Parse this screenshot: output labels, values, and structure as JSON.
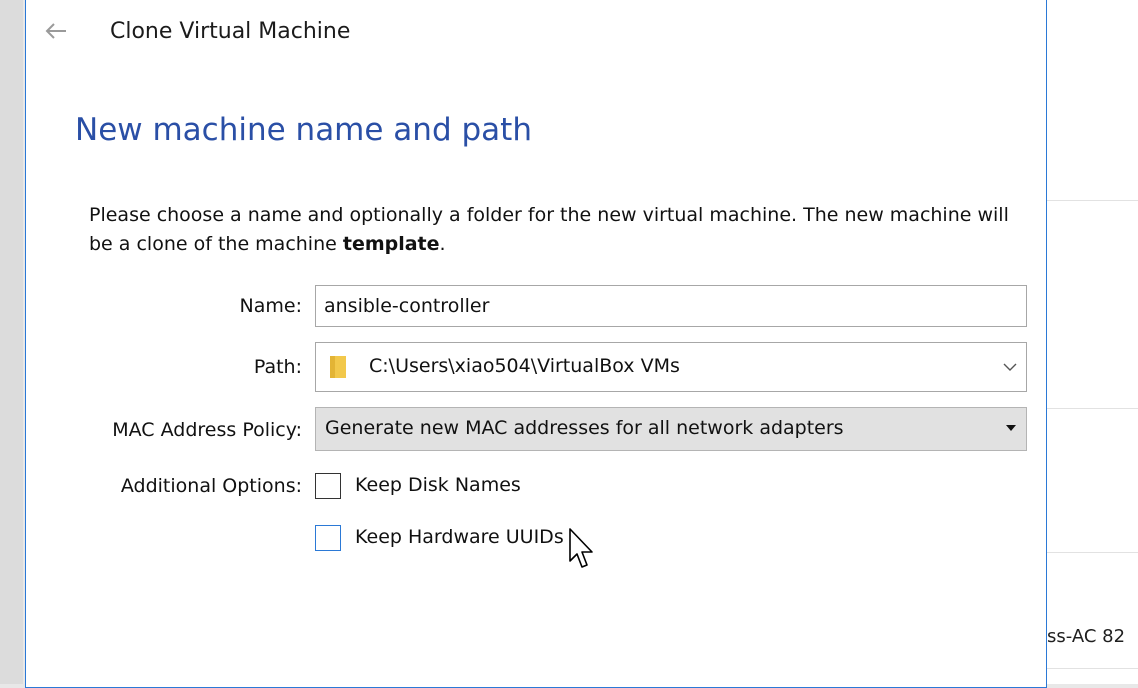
{
  "dialog": {
    "title": "Clone Virtual Machine",
    "heading": "New machine name and path",
    "description_part1": "Please choose a name and optionally a folder for the new virtual machine. The new machine will be a clone of the machine ",
    "description_bold": "template",
    "description_end": "."
  },
  "form": {
    "name_label": "Name:",
    "name_value": "ansible-controller",
    "path_label": "Path:",
    "path_value": "C:\\Users\\xiao504\\VirtualBox VMs",
    "mac_label": "MAC Address Policy:",
    "mac_value": "Generate new MAC addresses for all network adapters",
    "options_label": "Additional Options:",
    "keep_disk_names_label": "Keep Disk Names",
    "keep_disk_names_checked": false,
    "keep_hardware_uuids_label": "Keep Hardware UUIDs",
    "keep_hardware_uuids_checked": false
  },
  "background": {
    "partial_text": "ss-AC 82"
  },
  "colors": {
    "accent": "#2b79d6",
    "heading": "#2a4fa6",
    "folder": "#f2c84b"
  }
}
